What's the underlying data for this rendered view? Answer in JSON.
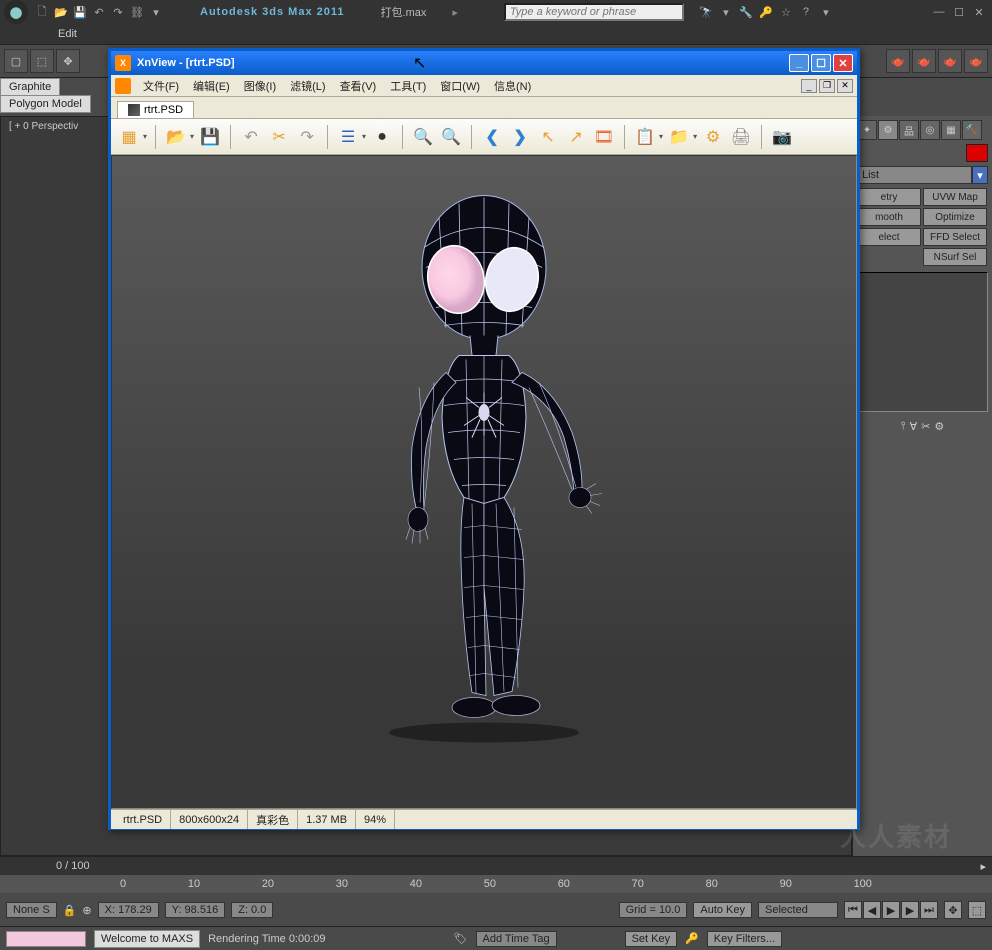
{
  "max": {
    "app_title": "Autodesk 3ds Max  2011",
    "filename": "打包.max",
    "search_placeholder": "Type a keyword or phrase",
    "menu": {
      "edit": "Edit"
    },
    "ribbon": {
      "graphite": "Graphite ",
      "polygon": "Polygon Model"
    },
    "viewport_label": "[ + 0 Perspectiv",
    "rightpanel": {
      "dropdown": "List",
      "buttons": [
        "etry",
        "UVW Map",
        "mooth",
        "Optimize",
        "elect",
        "FFD Select",
        "NSurf Sel"
      ]
    },
    "timeline": {
      "frame_label": "0 / 100",
      "ticks": [
        "0",
        "10",
        "20",
        "30",
        "40",
        "50",
        "60",
        "70",
        "80",
        "90",
        "100"
      ],
      "none": "None S",
      "x": "X: 178.29",
      "y": "Y: 98.516",
      "z": "Z: 0.0",
      "grid": "Grid = 10.0",
      "add_time_tag": "Add Time Tag",
      "auto_key": "Auto Key",
      "set_key": "Set Key",
      "selected": "Selected",
      "key_filters": "Key Filters..."
    },
    "statusbar": {
      "welcome": "Welcome to MAXS",
      "render_time": "Rendering Time  0:00:09"
    }
  },
  "xnview": {
    "title": "XnView - [rtrt.PSD]",
    "menu": [
      "文件(F)",
      "编辑(E)",
      "图像(I)",
      "滤镜(L)",
      "查看(V)",
      "工具(T)",
      "窗口(W)",
      "信息(N)"
    ],
    "tab": "rtrt.PSD",
    "status": {
      "file": "rtrt.PSD",
      "dims": "800x600x24",
      "mode": "真彩色",
      "size": "1.37 MB",
      "zoom": "94%"
    }
  },
  "watermark": "人人素材"
}
